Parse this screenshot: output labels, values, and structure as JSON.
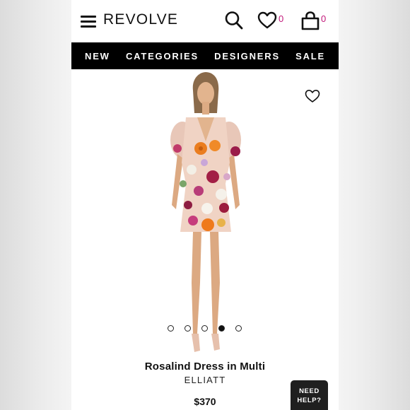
{
  "header": {
    "logo": "REVOLVE",
    "wishlist_count": "0",
    "bag_count": "0",
    "icons": [
      "menu-icon",
      "search-icon",
      "heart-icon",
      "bag-icon"
    ]
  },
  "nav": {
    "items": [
      "NEW",
      "CATEGORIES",
      "DESIGNERS",
      "SALE"
    ]
  },
  "product": {
    "name": "Rosalind Dress in Multi",
    "brand": "ELLIATT",
    "price": "$370",
    "image_count": 5,
    "active_image": 4
  },
  "help": {
    "line1": "NEED",
    "line2": "HELP?"
  },
  "colors": {
    "nav_bg": "#000000",
    "accent": "#c2187a",
    "text": "#111111"
  }
}
